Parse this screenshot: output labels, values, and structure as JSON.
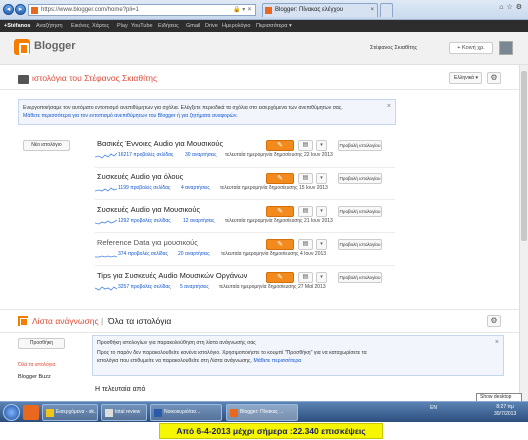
{
  "browser": {
    "url": "https://www.blogger.com/home?pli=1",
    "tabs": [
      {
        "label": "Blogger: Πίνακας ελέγχου"
      }
    ]
  },
  "google_bar": {
    "items": [
      "+Stéfanos",
      "Αναζήτηση",
      "Εικόνες",
      "Χάρτες",
      "Play",
      "YouTube",
      "Ειδήσεις",
      "Gmail",
      "Drive",
      "Ημερολόγιο",
      "Περισσότερα ▾"
    ]
  },
  "header": {
    "brand": "Blogger",
    "user": "Στέφανος Σκιαθίτης",
    "share_label": "+ Κοινή χρ."
  },
  "blogs_section": {
    "title": "ιστολόγια του Στέφανος Σκιαθίτης",
    "language": "Ελληνικά",
    "notice_line1": "Ενεργοποιήσαμε τον αυτόματο εντοπισμό ανεπιθύμητων για σχόλια. Ελέγξετε περιοδικά τα σχόλια στο εισερχόμενα των ανεπιθύμητων σας.",
    "notice_line2": "Μάθετε περισσότερα για τον εντοπισμό ανεπιθύμητων του Blogger ή για ζητήματα αναφορών.",
    "new_blog_label": "Νέο ιστολόγιο",
    "edit_glyph": "✎",
    "view_label": "Προβολή ιστολογίου",
    "blogs": [
      {
        "name": "Βασικές Έννοιες Audio για Μουσικούς",
        "views": "16217 προβολές σελίδας",
        "posts": "30 αναρτήσεις",
        "last": "τελευταία ημερομηνία δημοσίευσης 22 Ιουν 2013"
      },
      {
        "name": "Συσκευές Audio για όλους",
        "views": "1199 προβολές σελίδας",
        "posts": "4 αναρτήσεις",
        "last": "τελευταία ημερομηνία δημοσίευσης 15 Ιουν 2013"
      },
      {
        "name": "Συσκευές Audio για Μουσικούς",
        "views": "1292 προβολές σελίδας",
        "posts": "12 αναρτήσεις",
        "last": "τελευταία ημερομηνία δημοσίευσης 21 Ιουν 2013"
      },
      {
        "name": "Reference Data για μουσικούς",
        "views": "374 προβολές σελίδας",
        "posts": "20 αναρτήσεις",
        "last": "τελευταία ημερομηνία δημοσίευσης 4 Ιουν 2013"
      },
      {
        "name": "Tips για Συσκευές Audio Μουσικών Οργάνων",
        "views": "3257 προβολές σελίδας",
        "posts": "5 αναρτήσεις",
        "last": "τελευταία ημερομηνία δημοσίευσης 27 Μαΐ 2013"
      }
    ]
  },
  "reading_list": {
    "title": "Λίστα ανάγνωσης",
    "separator": "|",
    "all_blogs": "Όλα τα ιστολόγια",
    "add_label": "Προσθήκη",
    "side_link": "Όλα τα ιστολόγια",
    "side_item": "Blogger Buzz",
    "notice_line1": "Προσθήκη ιστολογίων για παρακολούθηση στη λίστα ανάγνωσής σας",
    "notice_line2": "Προς το παρόν δεν παρακολουθείτε κανένα ιστολόγιο. Χρησιμοποιήστε το κουμπί \"Προσθήκη\" για να καταχωρίσετε τα",
    "notice_line3": "ιστολόγια που επιθυμείτε να παρακολουθείτε στη Λίστα ανάγνωσης.",
    "notice_link": "Μάθετε περισσότερα",
    "latest": "Η τελευταία από"
  },
  "tooltip": "Show desktop",
  "taskbar": {
    "buttons": [
      "Εισερχόμενα - sk...",
      "total review",
      "Νοικοκυριό/ασ...",
      "Blogger: Πίνακας ..."
    ],
    "lang": "EN",
    "time": "8:27 πμ",
    "date": "30/7/2013"
  },
  "caption": "Από 6-4-2013 μέχρι σήμερα :22.340 επισκέψεις",
  "colors": {
    "accent": "#f28a1e",
    "title_red": "#dd4b39",
    "link_blue": "#1155cc",
    "caption_bg": "#f6f600"
  }
}
